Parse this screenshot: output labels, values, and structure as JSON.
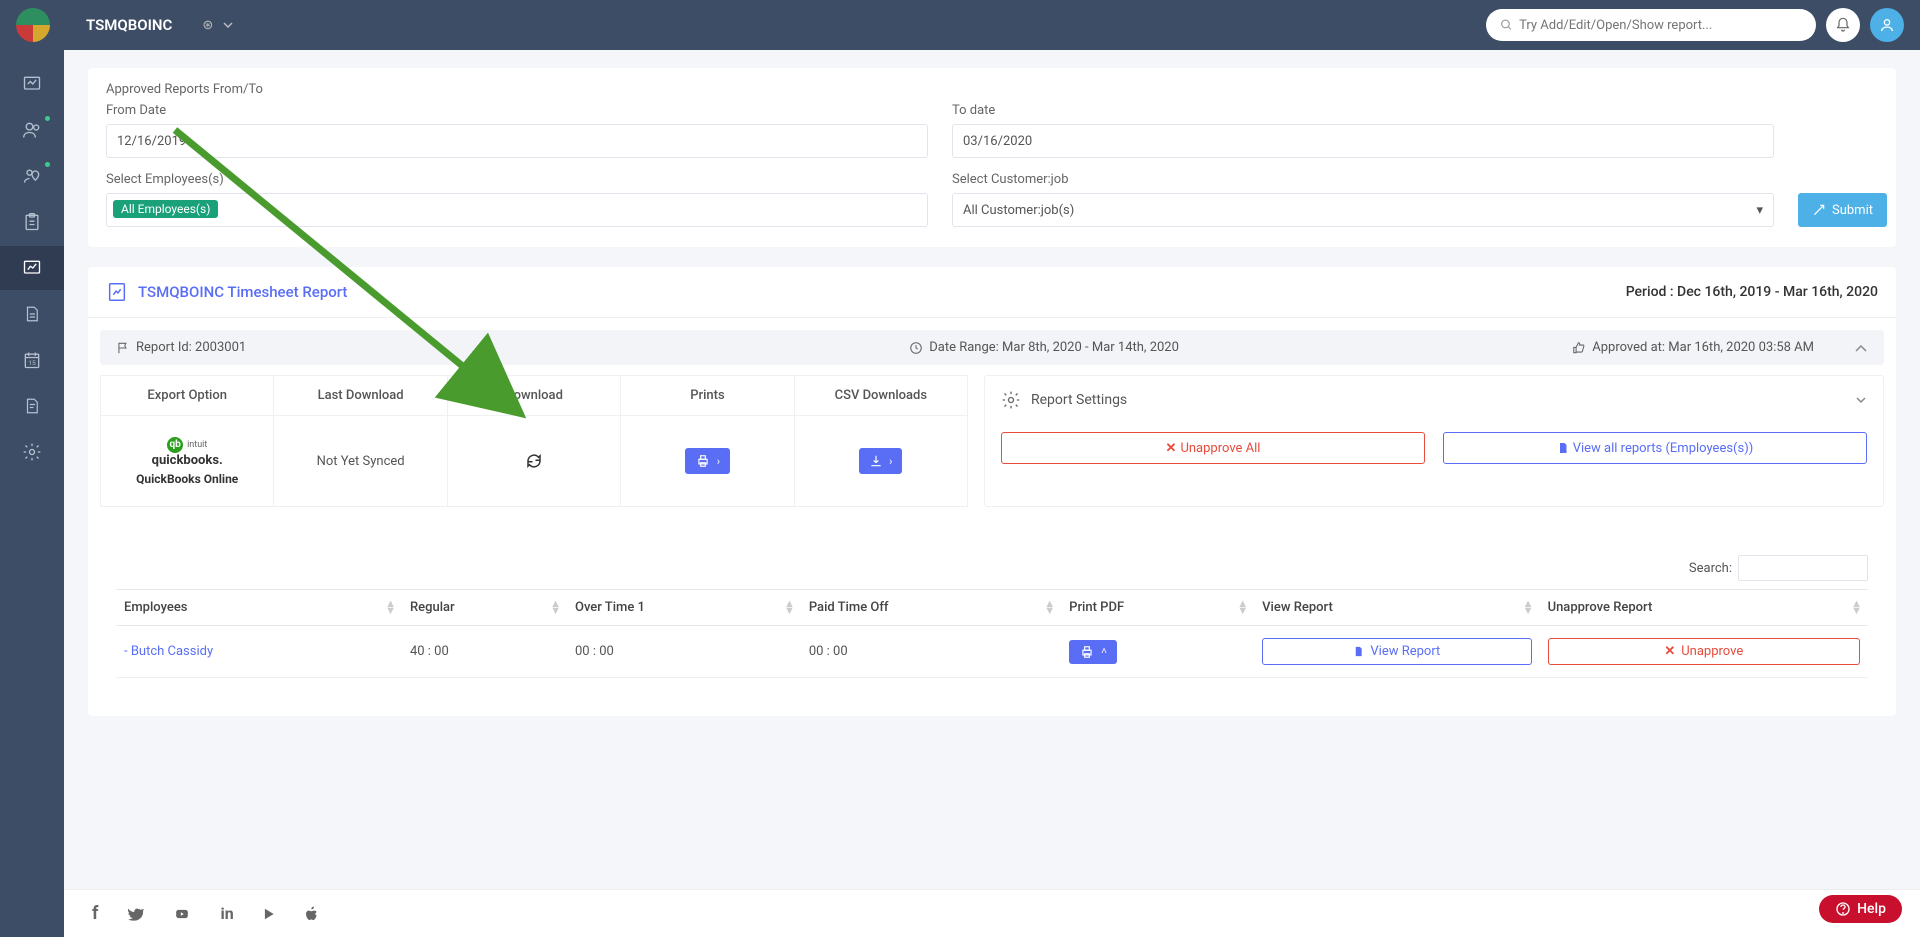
{
  "header": {
    "title": "TSMQBOINC",
    "currency": "⊛",
    "search_placeholder": "Try Add/Edit/Open/Show report..."
  },
  "filters": {
    "section_title": "Approved Reports From/To",
    "from_label": "From Date",
    "from_value": "12/16/2019",
    "to_label": "To date",
    "to_value": "03/16/2020",
    "emp_label": "Select Employees(s)",
    "emp_tag": "All Employees(s)",
    "cust_label": "Select Customer:job",
    "cust_value": "All Customer:job(s)",
    "submit": "Submit"
  },
  "report": {
    "title": "TSMQBOINC Timesheet Report",
    "period_label": "Period : Dec 16th, 2019 - Mar 16th, 2020",
    "meta_id": "Report Id: 2003001",
    "meta_date": "Date Range: Mar 8th, 2020 - Mar 14th, 2020",
    "meta_approved": "Approved at: Mar 16th, 2020 03:58 AM",
    "export_headers": [
      "Export Option",
      "Last Download",
      "Download",
      "Prints",
      "CSV Downloads"
    ],
    "qb_line1": "intuit",
    "qb_line2": "quickbooks.",
    "qb_line3": "QuickBooks Online",
    "last_download": "Not Yet Synced",
    "settings_title": "Report Settings",
    "unapprove_all": "Unapprove All",
    "view_all": "View all reports (Employees(s))"
  },
  "table": {
    "search_label": "Search:",
    "cols": [
      "Employees",
      "Regular",
      "Over Time 1",
      "Paid Time Off",
      "Print PDF",
      "View Report",
      "Unapprove Report"
    ],
    "rows": [
      {
        "name": "- Butch Cassidy",
        "regular": "40 : 00",
        "ot": "00 : 00",
        "pto": "00 : 00",
        "view": "View Report",
        "unapprove": "Unapprove"
      }
    ]
  },
  "help": "Help"
}
